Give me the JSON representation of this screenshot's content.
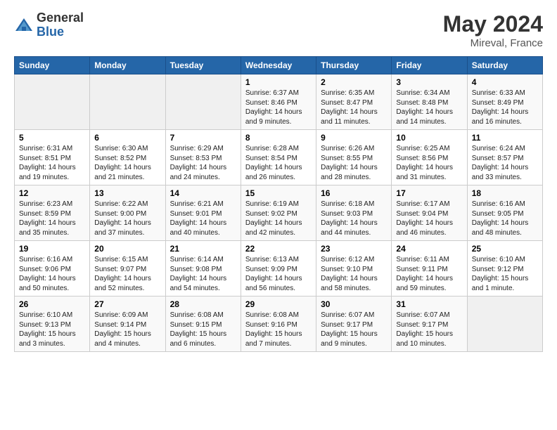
{
  "header": {
    "logo_general": "General",
    "logo_blue": "Blue",
    "title": "May 2024",
    "subtitle": "Mireval, France"
  },
  "days_of_week": [
    "Sunday",
    "Monday",
    "Tuesday",
    "Wednesday",
    "Thursday",
    "Friday",
    "Saturday"
  ],
  "weeks": [
    [
      {
        "num": "",
        "info": ""
      },
      {
        "num": "",
        "info": ""
      },
      {
        "num": "",
        "info": ""
      },
      {
        "num": "1",
        "info": "Sunrise: 6:37 AM\nSunset: 8:46 PM\nDaylight: 14 hours\nand 9 minutes."
      },
      {
        "num": "2",
        "info": "Sunrise: 6:35 AM\nSunset: 8:47 PM\nDaylight: 14 hours\nand 11 minutes."
      },
      {
        "num": "3",
        "info": "Sunrise: 6:34 AM\nSunset: 8:48 PM\nDaylight: 14 hours\nand 14 minutes."
      },
      {
        "num": "4",
        "info": "Sunrise: 6:33 AM\nSunset: 8:49 PM\nDaylight: 14 hours\nand 16 minutes."
      }
    ],
    [
      {
        "num": "5",
        "info": "Sunrise: 6:31 AM\nSunset: 8:51 PM\nDaylight: 14 hours\nand 19 minutes."
      },
      {
        "num": "6",
        "info": "Sunrise: 6:30 AM\nSunset: 8:52 PM\nDaylight: 14 hours\nand 21 minutes."
      },
      {
        "num": "7",
        "info": "Sunrise: 6:29 AM\nSunset: 8:53 PM\nDaylight: 14 hours\nand 24 minutes."
      },
      {
        "num": "8",
        "info": "Sunrise: 6:28 AM\nSunset: 8:54 PM\nDaylight: 14 hours\nand 26 minutes."
      },
      {
        "num": "9",
        "info": "Sunrise: 6:26 AM\nSunset: 8:55 PM\nDaylight: 14 hours\nand 28 minutes."
      },
      {
        "num": "10",
        "info": "Sunrise: 6:25 AM\nSunset: 8:56 PM\nDaylight: 14 hours\nand 31 minutes."
      },
      {
        "num": "11",
        "info": "Sunrise: 6:24 AM\nSunset: 8:57 PM\nDaylight: 14 hours\nand 33 minutes."
      }
    ],
    [
      {
        "num": "12",
        "info": "Sunrise: 6:23 AM\nSunset: 8:59 PM\nDaylight: 14 hours\nand 35 minutes."
      },
      {
        "num": "13",
        "info": "Sunrise: 6:22 AM\nSunset: 9:00 PM\nDaylight: 14 hours\nand 37 minutes."
      },
      {
        "num": "14",
        "info": "Sunrise: 6:21 AM\nSunset: 9:01 PM\nDaylight: 14 hours\nand 40 minutes."
      },
      {
        "num": "15",
        "info": "Sunrise: 6:19 AM\nSunset: 9:02 PM\nDaylight: 14 hours\nand 42 minutes."
      },
      {
        "num": "16",
        "info": "Sunrise: 6:18 AM\nSunset: 9:03 PM\nDaylight: 14 hours\nand 44 minutes."
      },
      {
        "num": "17",
        "info": "Sunrise: 6:17 AM\nSunset: 9:04 PM\nDaylight: 14 hours\nand 46 minutes."
      },
      {
        "num": "18",
        "info": "Sunrise: 6:16 AM\nSunset: 9:05 PM\nDaylight: 14 hours\nand 48 minutes."
      }
    ],
    [
      {
        "num": "19",
        "info": "Sunrise: 6:16 AM\nSunset: 9:06 PM\nDaylight: 14 hours\nand 50 minutes."
      },
      {
        "num": "20",
        "info": "Sunrise: 6:15 AM\nSunset: 9:07 PM\nDaylight: 14 hours\nand 52 minutes."
      },
      {
        "num": "21",
        "info": "Sunrise: 6:14 AM\nSunset: 9:08 PM\nDaylight: 14 hours\nand 54 minutes."
      },
      {
        "num": "22",
        "info": "Sunrise: 6:13 AM\nSunset: 9:09 PM\nDaylight: 14 hours\nand 56 minutes."
      },
      {
        "num": "23",
        "info": "Sunrise: 6:12 AM\nSunset: 9:10 PM\nDaylight: 14 hours\nand 58 minutes."
      },
      {
        "num": "24",
        "info": "Sunrise: 6:11 AM\nSunset: 9:11 PM\nDaylight: 14 hours\nand 59 minutes."
      },
      {
        "num": "25",
        "info": "Sunrise: 6:10 AM\nSunset: 9:12 PM\nDaylight: 15 hours\nand 1 minute."
      }
    ],
    [
      {
        "num": "26",
        "info": "Sunrise: 6:10 AM\nSunset: 9:13 PM\nDaylight: 15 hours\nand 3 minutes."
      },
      {
        "num": "27",
        "info": "Sunrise: 6:09 AM\nSunset: 9:14 PM\nDaylight: 15 hours\nand 4 minutes."
      },
      {
        "num": "28",
        "info": "Sunrise: 6:08 AM\nSunset: 9:15 PM\nDaylight: 15 hours\nand 6 minutes."
      },
      {
        "num": "29",
        "info": "Sunrise: 6:08 AM\nSunset: 9:16 PM\nDaylight: 15 hours\nand 7 minutes."
      },
      {
        "num": "30",
        "info": "Sunrise: 6:07 AM\nSunset: 9:17 PM\nDaylight: 15 hours\nand 9 minutes."
      },
      {
        "num": "31",
        "info": "Sunrise: 6:07 AM\nSunset: 9:17 PM\nDaylight: 15 hours\nand 10 minutes."
      },
      {
        "num": "",
        "info": ""
      }
    ]
  ]
}
